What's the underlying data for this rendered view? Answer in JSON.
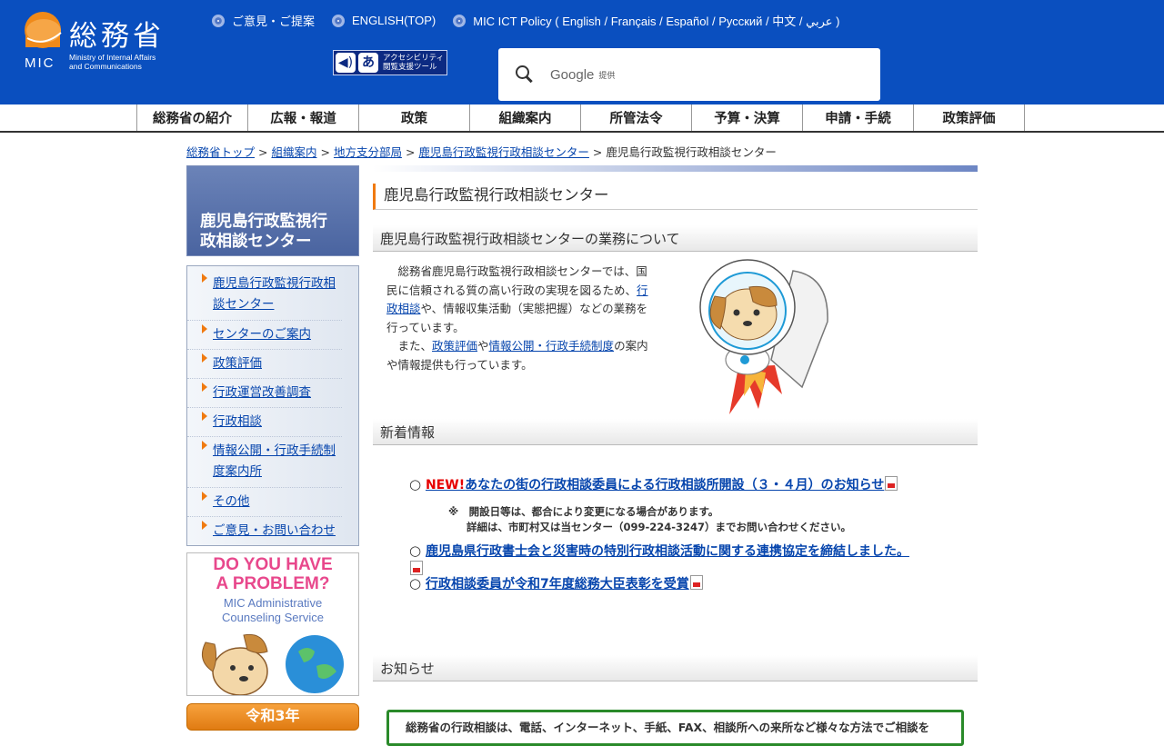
{
  "header": {
    "logo_jp": "総務省",
    "logo_mic": "MIC",
    "logo_en_line1": "Ministry of Internal Affairs",
    "logo_en_line2": "and Communications",
    "top_links": [
      "ご意見・ご提案",
      "ENGLISH(TOP)",
      "MIC ICT Policy ( English / Français / Español / Русский / 中文 / عربي )"
    ],
    "accessibility_label_line1": "アクセシビリティ",
    "accessibility_label_line2": "閲覧支援ツール",
    "search_brand": "Google",
    "search_provided": "提供"
  },
  "nav": [
    "総務省の紹介",
    "広報・報道",
    "政策",
    "組織案内",
    "所管法令",
    "予算・決算",
    "申請・手続",
    "政策評価"
  ],
  "breadcrumb": {
    "items": [
      "総務省トップ",
      "組織案内",
      "地方支分部局",
      "鹿児島行政監視行政相談センター"
    ],
    "separator": ">",
    "current": "鹿児島行政監視行政相談センター"
  },
  "sidebar": {
    "title_line1": "鹿児島行政監視行",
    "title_line2": "政相談センター",
    "items": [
      "鹿児島行政監視行政相談センター",
      "センターのご案内",
      "政策評価",
      "行政運営改善調査",
      "行政相談",
      "情報公開・行政手続制度案内所",
      "その他",
      "ご意見・お問い合わせ"
    ],
    "banner_title_line1": "DO YOU HAVE",
    "banner_title_line2": "A PROBLEM?",
    "banner_sub_line1": "MIC Administrative",
    "banner_sub_line2": "Counseling Service",
    "banner2_label": "令和3年"
  },
  "main": {
    "page_title": "鹿児島行政監視行政相談センター",
    "section1_title": "鹿児島行政監視行政相談センターの業務について",
    "intro": {
      "p1_before": "　総務省鹿児島行政監視行政相談センターでは、国民に信頼される質の高い行政の実現を図るため、",
      "p1_link": "行政相談",
      "p1_after": "や、情報収集活動（実態把握）などの業務を行っています。",
      "p2_before": "　また、",
      "p2_link1": "政策評価",
      "p2_mid": "や",
      "p2_link2": "情報公開・行政手続制度",
      "p2_after": "の案内や情報提供も行っています。"
    },
    "section2_title": "新着情報",
    "news": [
      {
        "badge": "NEW!",
        "text": "あなたの街の行政相談委員による行政相談所開設（３・４月）のお知らせ"
      },
      {
        "text": "鹿児島県行政書士会と災害時の特別行政相談活動に関する連携協定を締結しました。"
      },
      {
        "text": "行政相談委員が令和7年度総務大臣表彰を受賞"
      }
    ],
    "bullet": "○",
    "note_line1": "※　開設日等は、都合により変更になる場合があります。",
    "note_line2": "詳細は、市町村又は当センター（099-224-3247）までお問い合わせください。",
    "section3_title": "お知らせ",
    "info_box_text": "総務省の行政相談は、電話、インターネット、手紙、FAX、相談所への来所など様々な方法でご相談を"
  },
  "colors": {
    "header_bg": "#0a4fbf",
    "accent_orange": "#f07a10",
    "new_red": "#e60000",
    "link": "#0645ad"
  }
}
